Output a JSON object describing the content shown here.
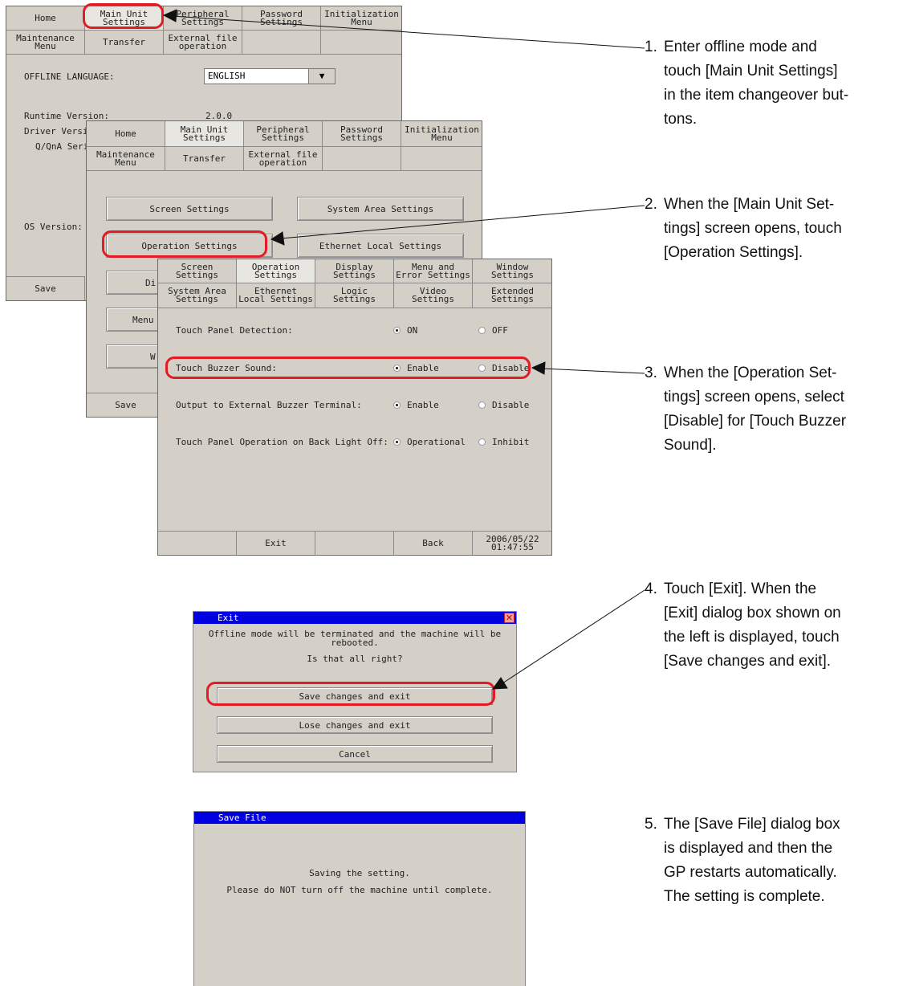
{
  "screen1": {
    "tabs_row1": [
      "Home",
      "Main Unit\nSettings",
      "Peripheral\nSettings",
      "Password\nSettings",
      "Initialization\nMenu"
    ],
    "tabs_row2": [
      "Maintenance\nMenu",
      "Transfer",
      "External file\noperation",
      "",
      ""
    ],
    "offline_language_label": "OFFLINE LANGUAGE:",
    "offline_language_value": "ENGLISH",
    "runtime_version_label": "Runtime Version:",
    "runtime_version_value": "2.0.0",
    "driver_version_label": "Driver Versio",
    "driver_name": "Q/QnA Seri",
    "os_version_label": "OS Version:",
    "save_label": "Save"
  },
  "screen2": {
    "tabs_row1": [
      "Home",
      "Main Unit\nSettings",
      "Peripheral\nSettings",
      "Password\nSettings",
      "Initialization\nMenu"
    ],
    "tabs_row2": [
      "Maintenance\nMenu",
      "Transfer",
      "External file\noperation",
      "",
      ""
    ],
    "buttons": {
      "screen_settings": "Screen Settings",
      "system_area_settings": "System Area Settings",
      "operation_settings": "Operation Settings",
      "ethernet_local_settings": "Ethernet Local Settings",
      "di_partial": "Di",
      "menu_partial": "Menu",
      "w_partial": "W"
    },
    "save_label": "Save"
  },
  "screen3": {
    "tabs_row1": [
      "Screen\nSettings",
      "Operation\nSettings",
      "Display\nSettings",
      "Menu and\nError Settings",
      "Window\nSettings"
    ],
    "tabs_row2": [
      "System Area\nSettings",
      "Ethernet\nLocal Settings",
      "Logic\nSettings",
      "Video\nSettings",
      "Extended\nSettings"
    ],
    "settings": [
      {
        "label": "Touch Panel Detection:",
        "opt1": "ON",
        "opt2": "OFF"
      },
      {
        "label": "Touch Buzzer Sound:",
        "opt1": "Enable",
        "opt2": "Disable"
      },
      {
        "label": "Output to External Buzzer Terminal:",
        "opt1": "Enable",
        "opt2": "Disable"
      },
      {
        "label": "Touch Panel Operation on Back Light Off:",
        "opt1": "Operational",
        "opt2": "Inhibit"
      }
    ],
    "exit_label": "Exit",
    "back_label": "Back",
    "date": "2006/05/22",
    "time": "01:47:55"
  },
  "exit_dialog": {
    "title": "Exit",
    "message_line1": "Offline mode will be terminated and the machine will be",
    "message_line2": "rebooted.",
    "question": "Is that all right?",
    "save_exit": "Save changes and exit",
    "lose_exit": "Lose changes and exit",
    "cancel": "Cancel"
  },
  "save_dialog": {
    "title": "Save File",
    "message_line1": "Saving the setting.",
    "message_line2": "Please do NOT turn off the machine until complete."
  },
  "steps": [
    {
      "num": "1.",
      "lines": [
        "Enter offline mode and",
        "touch [Main Unit Settings]",
        "in the item changeover but-",
        "tons."
      ]
    },
    {
      "num": "2.",
      "lines": [
        "When the [Main Unit Set-",
        "tings] screen opens, touch",
        "[Operation Settings]."
      ]
    },
    {
      "num": "3.",
      "lines": [
        "When the [Operation Set-",
        "tings] screen opens, select",
        "[Disable] for [Touch Buzzer",
        "Sound]."
      ]
    },
    {
      "num": "4.",
      "lines": [
        "Touch [Exit]. When the",
        "[Exit] dialog box shown on",
        "the left is displayed, touch",
        "[Save changes and exit]."
      ]
    },
    {
      "num": "5.",
      "lines": [
        "The [Save File] dialog box",
        "is displayed and then the",
        "GP restarts automatically.",
        "The setting is complete."
      ]
    }
  ],
  "colors": {
    "highlight": "#e31b23",
    "panel": "#d4d0c8",
    "titlebar": "#0000e0"
  }
}
